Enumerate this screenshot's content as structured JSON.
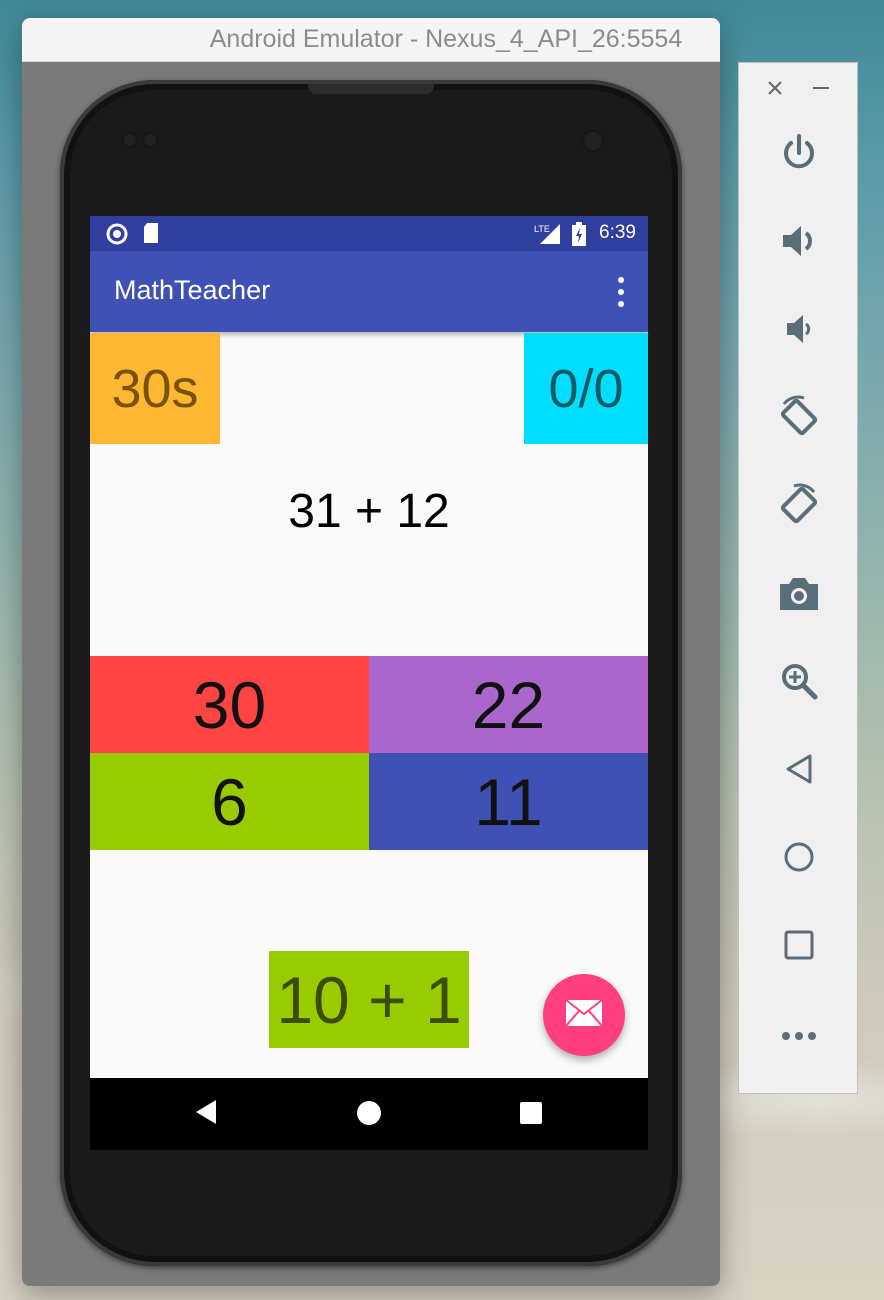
{
  "window": {
    "title": "Android Emulator - Nexus_4_API_26:5554"
  },
  "status_bar": {
    "network": "LTE",
    "time": "6:39"
  },
  "app_bar": {
    "title": "MathTeacher"
  },
  "game": {
    "timer": "30s",
    "score": "0/0",
    "question": "31 + 12",
    "answers": [
      {
        "label": "30",
        "color": "#ff4444"
      },
      {
        "label": "22",
        "color": "#aa66cc"
      },
      {
        "label": "6",
        "color": "#99cc00"
      },
      {
        "label": "11",
        "color": "#3f51b5"
      }
    ],
    "hint": "10 + 1"
  },
  "colors": {
    "status_bar": "#303f9f",
    "app_bar": "#3f51b5",
    "timer_bg": "#ffb733",
    "score_bg": "#00ddff",
    "fab": "#ff3f7f",
    "panel_icon": "#5a6e7a"
  },
  "side_panel": {
    "buttons": [
      {
        "icon": "power-icon"
      },
      {
        "icon": "volume-up-icon"
      },
      {
        "icon": "volume-down-icon"
      },
      {
        "icon": "rotate-left-icon"
      },
      {
        "icon": "rotate-right-icon"
      },
      {
        "icon": "camera-icon"
      },
      {
        "icon": "zoom-icon"
      },
      {
        "icon": "back-icon"
      },
      {
        "icon": "home-icon"
      },
      {
        "icon": "overview-icon"
      },
      {
        "icon": "more-icon"
      }
    ]
  }
}
